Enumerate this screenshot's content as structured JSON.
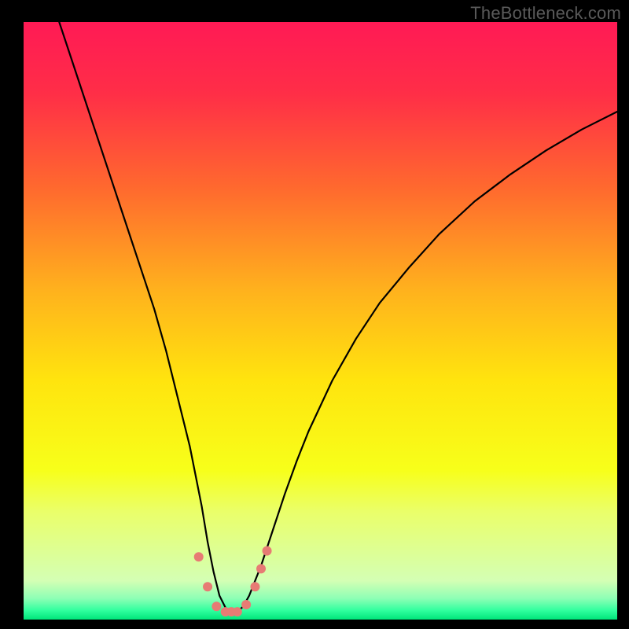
{
  "attribution": "TheBottleneck.com",
  "frame": {
    "outer_width": 800,
    "outer_height": 800,
    "inner_left": 30,
    "inner_top": 28,
    "inner_width": 755,
    "inner_height": 760
  },
  "chart_data": {
    "type": "line",
    "title": "",
    "xlabel": "",
    "ylabel": "",
    "xlim": [
      0,
      100
    ],
    "ylim": [
      0,
      100
    ],
    "gradient_stops": [
      {
        "offset": 0.0,
        "color": "#ff1a55"
      },
      {
        "offset": 0.12,
        "color": "#ff2e47"
      },
      {
        "offset": 0.28,
        "color": "#ff6a2e"
      },
      {
        "offset": 0.45,
        "color": "#ffb21d"
      },
      {
        "offset": 0.6,
        "color": "#ffe40e"
      },
      {
        "offset": 0.75,
        "color": "#f7ff1a"
      },
      {
        "offset": 0.82,
        "color": "#eaff6a"
      },
      {
        "offset": 0.935,
        "color": "#d4ffb4"
      },
      {
        "offset": 0.965,
        "color": "#8cffb5"
      },
      {
        "offset": 0.985,
        "color": "#2fff9e"
      },
      {
        "offset": 1.0,
        "color": "#00e57a"
      }
    ],
    "series": [
      {
        "name": "bottleneck-curve",
        "color": "#000000",
        "stroke_width": 2.2,
        "x": [
          6.0,
          9,
          12,
          15,
          18,
          20,
          22,
          24,
          26,
          28,
          30,
          31,
          32,
          33,
          34,
          35,
          36,
          37,
          38,
          40,
          42,
          44,
          46,
          48,
          52,
          56,
          60,
          65,
          70,
          76,
          82,
          88,
          94,
          100
        ],
        "values": [
          100,
          91,
          82,
          73,
          64,
          58,
          52,
          45,
          37,
          29,
          19,
          13,
          8,
          4,
          2,
          1.3,
          1.3,
          2.2,
          4,
          9,
          15,
          21,
          26.5,
          31.5,
          40,
          47,
          53,
          59,
          64.5,
          70,
          74.5,
          78.5,
          82,
          85
        ]
      }
    ],
    "markers": {
      "name": "highlight-points",
      "color": "#e77b74",
      "radius": 6,
      "points": [
        {
          "x": 29.5,
          "y": 10.5
        },
        {
          "x": 31.0,
          "y": 5.5
        },
        {
          "x": 32.5,
          "y": 2.2
        },
        {
          "x": 34.0,
          "y": 1.3
        },
        {
          "x": 35.0,
          "y": 1.3
        },
        {
          "x": 36.0,
          "y": 1.3
        },
        {
          "x": 37.5,
          "y": 2.5
        },
        {
          "x": 39.0,
          "y": 5.5
        },
        {
          "x": 40.0,
          "y": 8.5
        },
        {
          "x": 41.0,
          "y": 11.5
        }
      ]
    }
  }
}
